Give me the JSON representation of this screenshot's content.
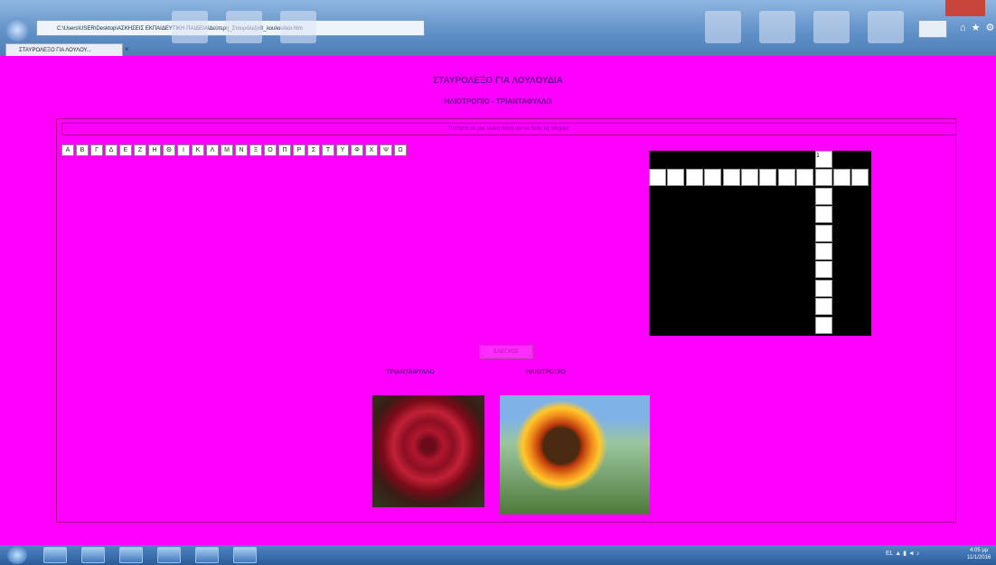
{
  "browser": {
    "address": "C:\\Users\\USER\\Desktop\\ΑΣΚΗΣΕΙΣ ΕΚΠΑΙΔΕΥΤΙΚΗ ΠΑΙΔΕΙΑ\\Δεύτερη_ΣταυρόλεξοΒ_λουλουδιαι.htm",
    "tab_title": "ΣΤΑΥΡΟΛΕΞΟ ΓΙΑ ΛΟΥΛΟΥ..."
  },
  "page": {
    "title": "ΣΤΑΥΡΟΛΕΞΟ ΓΙΑ ΛΟΥΛΟΥΔΙΑ",
    "subtitle": "ΗΛΙΟΤΡΟΠΙΟ - ΤΡΙΑΝΤΑΦΥΛΛΟ",
    "instruction": "Πατήστε σε μια λευκή θέση για να δείτε τις οδηγίες",
    "letters": [
      "Α",
      "Β",
      "Γ",
      "Δ",
      "Ε",
      "Ζ",
      "Η",
      "Θ",
      "Ι",
      "Κ",
      "Λ",
      "Μ",
      "Ν",
      "Ξ",
      "Ο",
      "Π",
      "Ρ",
      "Σ",
      "Τ",
      "Υ",
      "Φ",
      "Χ",
      "Ψ",
      "Ω"
    ],
    "check_label": "ΕΛΕΓΧΟΣ",
    "crossword": {
      "clue_numbers": [
        "1",
        "2"
      ]
    },
    "images": [
      {
        "caption": "ΤΡΙΑΝΤΑΦΥΛΛΟ",
        "name": "rose-photo"
      },
      {
        "caption": "ΗΛΙΟΤΡΟΠΙΟ",
        "name": "sunflower-photo"
      }
    ]
  },
  "taskbar": {
    "tray_text": "EL ▲ ▮ ◄ ♪",
    "time": "4:05 μμ",
    "date": "11/1/2016"
  },
  "colors": {
    "page_background": "#ff00ff",
    "title_text": "#6a0b8c",
    "crossword_background": "#000000"
  }
}
